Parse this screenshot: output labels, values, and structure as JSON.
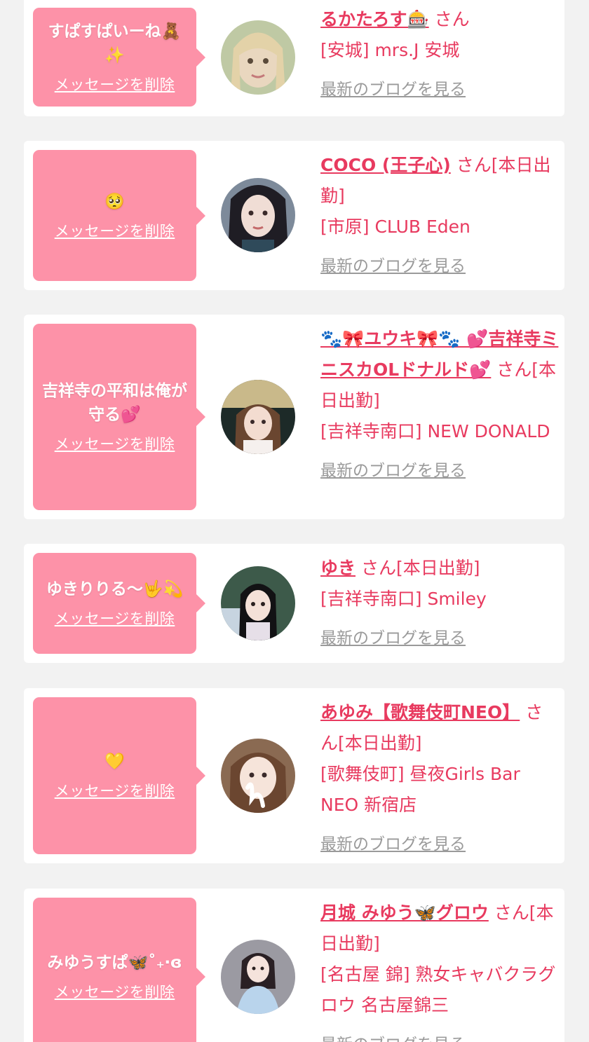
{
  "delete_label": "メッセージを削除",
  "blog_label": "最新のブログを見る",
  "colors": {
    "accent": "#e83a5f",
    "bubble": "#fd92a8",
    "background": "#f2f2f2",
    "link_gray": "#9a9a9a"
  },
  "cards": [
    {
      "message": "すぱすぱいーね🧸✨",
      "name": "るかたろす🎰",
      "suffix": "さん",
      "shop": "[安城] mrs.J 安城",
      "avatar_icon": "avatar-photo"
    },
    {
      "message": "🥺",
      "name": "COCO (王子心)",
      "suffix": "さん[本日出勤]",
      "shop": "[市原] CLUB Eden",
      "avatar_icon": "avatar-photo"
    },
    {
      "message": "吉祥寺の平和は俺が守る💕",
      "name": "🐾🎀ユウキ🎀🐾 💕吉祥寺ミニスカOLドナルド💕",
      "suffix": "さん[本日出勤]",
      "shop": "[吉祥寺南口] NEW DONALD",
      "avatar_icon": "avatar-photo"
    },
    {
      "message": "ゆきりりる〜🤟💫",
      "name": "ゆき",
      "suffix": "さん[本日出勤]",
      "shop": "[吉祥寺南口] Smiley",
      "avatar_icon": "avatar-photo"
    },
    {
      "message": "💛",
      "name": "あゆみ【歌舞伎町NEO】",
      "suffix": "さん[本日出勤]",
      "shop": "[歌舞伎町] 昼夜Girls Bar NEO 新宿店",
      "avatar_icon": "avatar-photo"
    },
    {
      "message": "みゆうすぱ🦋˚₊‧ɞ",
      "name": "月城 みゆう🦋グロウ",
      "suffix": "さん[本日出勤]",
      "shop": "[名古屋 錦] 熟女キャバクラグロウ 名古屋錦三",
      "avatar_icon": "avatar-photo"
    }
  ]
}
